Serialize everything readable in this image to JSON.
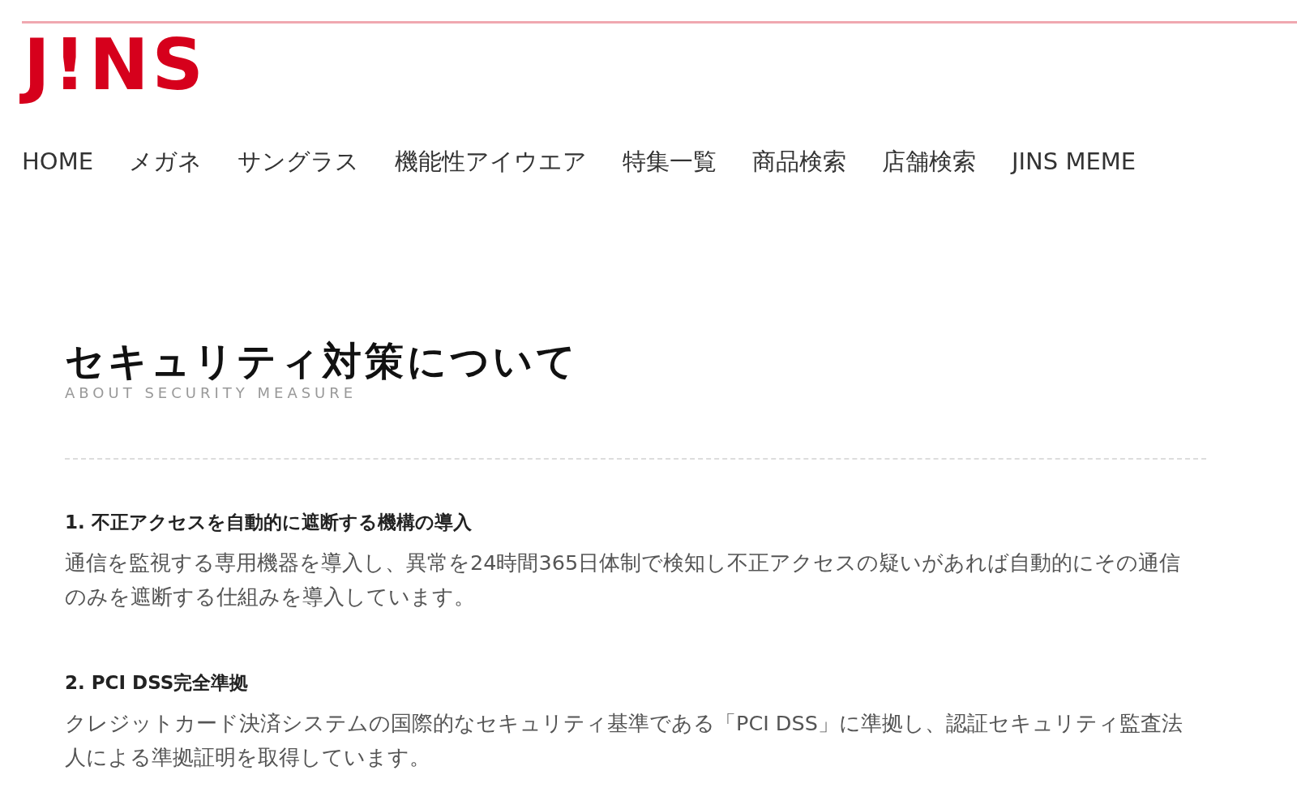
{
  "logo": "J!NS",
  "nav": [
    "HOME",
    "メガネ",
    "サングラス",
    "機能性アイウエア",
    "特集一覧",
    "商品検索",
    "店舗検索",
    "JINS MEME"
  ],
  "page": {
    "title": "セキュリティ対策について",
    "subtitle": "ABOUT SECURITY MEASURE"
  },
  "sections": [
    {
      "heading": "1. 不正アクセスを自動的に遮断する機構の導入",
      "body": "通信を監視する専用機器を導入し、異常を24時間365日体制で検知し不正アクセスの疑いがあれば自動的にその通信のみを遮断する仕組みを導入しています。"
    },
    {
      "heading": "2. PCI DSS完全準拠",
      "body": "クレジットカード決済システムの国際的なセキュリティ基準である「PCI DSS」に準拠し、認証セキュリティ監査法人による準拠証明を取得しています。"
    }
  ]
}
